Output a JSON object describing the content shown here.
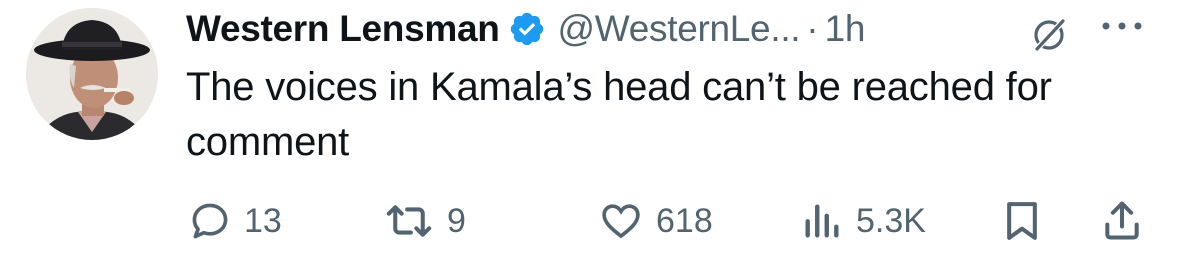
{
  "author": {
    "name": "Western Lensman",
    "handle": "@WesternLe...",
    "separator": "·",
    "time": "1h"
  },
  "tweet": {
    "text": "The voices in Kamala’s head can’t be reached for comment"
  },
  "actions": {
    "replies": "13",
    "reposts": "9",
    "likes": "618",
    "views": "5.3K"
  },
  "icons": {
    "verified": "verified-badge-icon",
    "grok": "grok-icon",
    "more": "more-icon",
    "reply": "reply-icon",
    "repost": "repost-icon",
    "like": "heart-icon",
    "views": "views-icon",
    "bookmark": "bookmark-icon",
    "share": "share-icon"
  },
  "colors": {
    "text": "#0f1419",
    "secondary": "#536471",
    "verified": "#1d9bf0"
  }
}
